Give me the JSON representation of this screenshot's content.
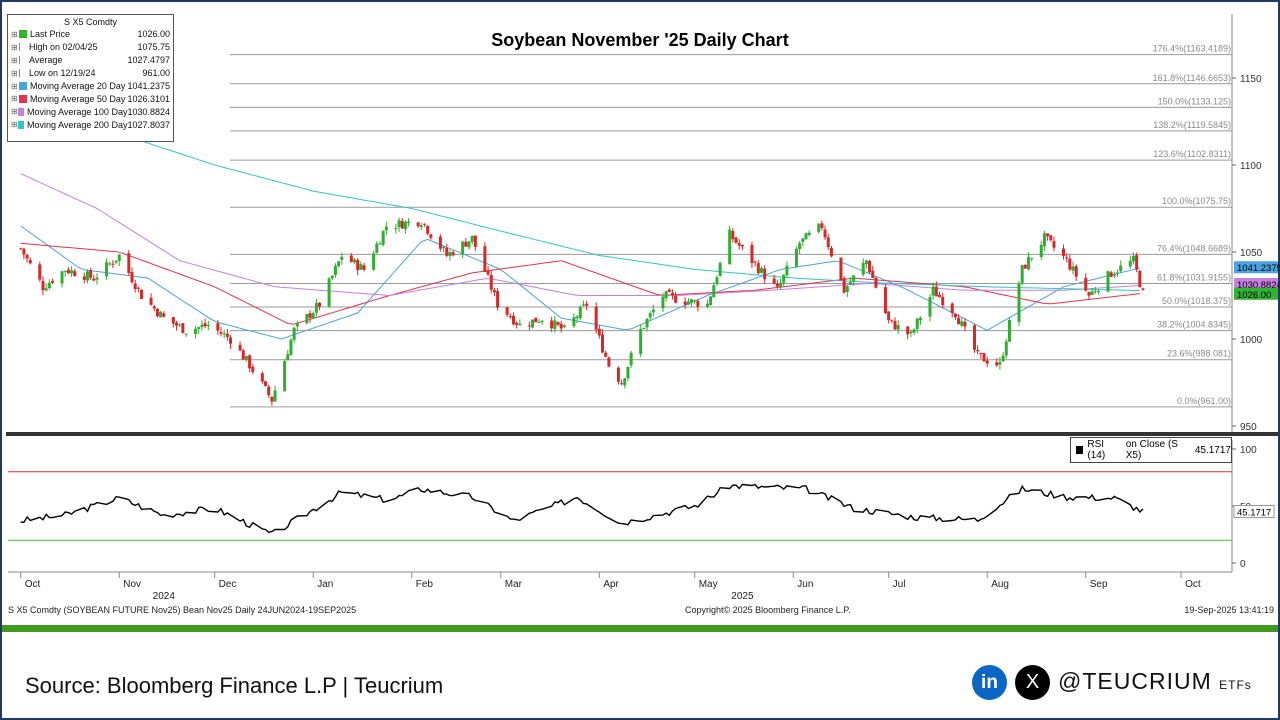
{
  "title": "Soybean November '25 Daily Chart",
  "legend": {
    "title": "S X5 Comdty",
    "rows": [
      {
        "label": "Last Price",
        "value": "1026.00",
        "color": "#2fb52f"
      },
      {
        "label": "High on 02/04/25",
        "value": "1075.75",
        "color": ""
      },
      {
        "label": "Average",
        "value": "1027.4797",
        "color": ""
      },
      {
        "label": "Low on 12/19/24",
        "value": "961.00",
        "color": ""
      },
      {
        "label": "Moving Average 20 Day",
        "value": "1041.2375",
        "color": "#4aa3df"
      },
      {
        "label": "Moving Average 50 Day",
        "value": "1026.3101",
        "color": "#e8314c"
      },
      {
        "label": "Moving Average 100 Day",
        "value": "1030.8824",
        "color": "#c77fe0"
      },
      {
        "label": "Moving Average 200 Day",
        "value": "1027.8037",
        "color": "#2ec7c7"
      }
    ]
  },
  "fib_levels": [
    {
      "label": "176.4%(1163.4189)",
      "value": 1163.4189
    },
    {
      "label": "161.8%(1146.6653)",
      "value": 1146.6653
    },
    {
      "label": "150.0%(1133.125)",
      "value": 1133.125
    },
    {
      "label": "138.2%(1119.5845)",
      "value": 1119.5845
    },
    {
      "label": "123.6%(1102.8311)",
      "value": 1102.8311
    },
    {
      "label": "100.0%(1075.75)",
      "value": 1075.75
    },
    {
      "label": "76.4%(1048.6689)",
      "value": 1048.6689
    },
    {
      "label": "61.8%(1031.9155)",
      "value": 1031.9155
    },
    {
      "label": "50.0%(1018.375)",
      "value": 1018.375
    },
    {
      "label": "38.2%(1004.8345)",
      "value": 1004.8345
    },
    {
      "label": "23.6%(988.081)",
      "value": 988.081
    },
    {
      "label": "0.0%(961.00)",
      "value": 961.0
    }
  ],
  "price_axis": {
    "ticks": [
      "1150",
      "1100",
      "1050",
      "1000",
      "950"
    ],
    "range": [
      950,
      1165
    ]
  },
  "rsi_axis": {
    "ticks": [
      "100",
      "50",
      "0"
    ],
    "overbought": 80,
    "oversold": 20
  },
  "price_tags": [
    {
      "text": "1041.2375",
      "value": 1041.2375,
      "bg": "#4aa3df"
    },
    {
      "text": "1030.8824",
      "value": 1031.6,
      "bg": "#c77fe0"
    },
    {
      "text": "1026.00",
      "value": 1026.0,
      "bg": "#2fb52f"
    }
  ],
  "rsi_box": {
    "label": "RSI (14)",
    "text": "on Close (S X5)",
    "value": "45.1717"
  },
  "rsi_tag": "45.1717",
  "months": [
    "Oct",
    "Nov",
    "Dec",
    "Jan",
    "Feb",
    "Mar",
    "Apr",
    "May",
    "Jun",
    "Jul",
    "Aug",
    "Sep",
    "Oct"
  ],
  "years": [
    "2024",
    "2025"
  ],
  "footer": {
    "left": "S X5 Comdty (SOYBEAN FUTURE   Nov25) Bean Nov25  Daily 24JUN2024-19SEP2025",
    "center": "Copyright© 2025 Bloomberg Finance L.P.",
    "right": "19-Sep-2025 13:41:19"
  },
  "source": "Source: Bloomberg Finance L.P | Teucrium",
  "social": {
    "linkedin": "in",
    "x": "X",
    "handle": "@TEUCRIUM",
    "handle_suffix": "ETFs"
  },
  "chart_data": {
    "type": "line",
    "title": "Soybean November '25 Daily Chart",
    "x_range": [
      "2024-10-01",
      "2025-09-19"
    ],
    "ylim": [
      950,
      1165
    ],
    "close_keypoints": [
      {
        "date": "2024-10-01",
        "value": 1052
      },
      {
        "date": "2024-10-08",
        "value": 1030
      },
      {
        "date": "2024-10-15",
        "value": 1040
      },
      {
        "date": "2024-10-24",
        "value": 1035
      },
      {
        "date": "2024-11-01",
        "value": 1048
      },
      {
        "date": "2024-11-08",
        "value": 1025
      },
      {
        "date": "2024-11-15",
        "value": 1012
      },
      {
        "date": "2024-11-22",
        "value": 1005
      },
      {
        "date": "2024-11-29",
        "value": 1008
      },
      {
        "date": "2024-12-06",
        "value": 1000
      },
      {
        "date": "2024-12-12",
        "value": 985
      },
      {
        "date": "2024-12-19",
        "value": 965
      },
      {
        "date": "2024-12-26",
        "value": 1005
      },
      {
        "date": "2025-01-03",
        "value": 1020
      },
      {
        "date": "2025-01-10",
        "value": 1048
      },
      {
        "date": "2025-01-17",
        "value": 1040
      },
      {
        "date": "2025-01-24",
        "value": 1065
      },
      {
        "date": "2025-02-04",
        "value": 1068
      },
      {
        "date": "2025-02-12",
        "value": 1048
      },
      {
        "date": "2025-02-20",
        "value": 1058
      },
      {
        "date": "2025-02-28",
        "value": 1020
      },
      {
        "date": "2025-03-07",
        "value": 1008
      },
      {
        "date": "2025-03-14",
        "value": 1012
      },
      {
        "date": "2025-03-21",
        "value": 1005
      },
      {
        "date": "2025-03-28",
        "value": 1020
      },
      {
        "date": "2025-04-04",
        "value": 985
      },
      {
        "date": "2025-04-08",
        "value": 975
      },
      {
        "date": "2025-04-14",
        "value": 1005
      },
      {
        "date": "2025-04-21",
        "value": 1025
      },
      {
        "date": "2025-04-28",
        "value": 1022
      },
      {
        "date": "2025-05-05",
        "value": 1020
      },
      {
        "date": "2025-05-12",
        "value": 1060
      },
      {
        "date": "2025-05-19",
        "value": 1045
      },
      {
        "date": "2025-05-27",
        "value": 1028
      },
      {
        "date": "2025-06-03",
        "value": 1055
      },
      {
        "date": "2025-06-10",
        "value": 1065
      },
      {
        "date": "2025-06-17",
        "value": 1028
      },
      {
        "date": "2025-06-24",
        "value": 1045
      },
      {
        "date": "2025-07-01",
        "value": 1010
      },
      {
        "date": "2025-07-08",
        "value": 1002
      },
      {
        "date": "2025-07-15",
        "value": 1028
      },
      {
        "date": "2025-07-22",
        "value": 1015
      },
      {
        "date": "2025-07-29",
        "value": 990
      },
      {
        "date": "2025-08-05",
        "value": 985
      },
      {
        "date": "2025-08-12",
        "value": 1040
      },
      {
        "date": "2025-08-19",
        "value": 1058
      },
      {
        "date": "2025-08-26",
        "value": 1045
      },
      {
        "date": "2025-09-02",
        "value": 1025
      },
      {
        "date": "2025-09-09",
        "value": 1038
      },
      {
        "date": "2025-09-16",
        "value": 1045
      },
      {
        "date": "2025-09-19",
        "value": 1026
      }
    ],
    "series": [
      {
        "name": "Moving Average 20 Day",
        "keypoints": [
          {
            "date": "2024-10-01",
            "value": 1065
          },
          {
            "date": "2024-10-20",
            "value": 1040
          },
          {
            "date": "2024-11-10",
            "value": 1035
          },
          {
            "date": "2024-12-01",
            "value": 1010
          },
          {
            "date": "2024-12-22",
            "value": 1000
          },
          {
            "date": "2025-01-15",
            "value": 1015
          },
          {
            "date": "2025-02-05",
            "value": 1058
          },
          {
            "date": "2025-03-01",
            "value": 1040
          },
          {
            "date": "2025-03-20",
            "value": 1012
          },
          {
            "date": "2025-04-10",
            "value": 1005
          },
          {
            "date": "2025-05-05",
            "value": 1025
          },
          {
            "date": "2025-05-28",
            "value": 1040
          },
          {
            "date": "2025-06-15",
            "value": 1045
          },
          {
            "date": "2025-07-05",
            "value": 1030
          },
          {
            "date": "2025-08-01",
            "value": 1005
          },
          {
            "date": "2025-08-25",
            "value": 1030
          },
          {
            "date": "2025-09-19",
            "value": 1041.24
          }
        ]
      },
      {
        "name": "Moving Average 50 Day",
        "keypoints": [
          {
            "date": "2024-10-01",
            "value": 1055
          },
          {
            "date": "2024-11-01",
            "value": 1050
          },
          {
            "date": "2024-12-01",
            "value": 1030
          },
          {
            "date": "2024-12-25",
            "value": 1008
          },
          {
            "date": "2025-01-25",
            "value": 1025
          },
          {
            "date": "2025-02-20",
            "value": 1038
          },
          {
            "date": "2025-03-20",
            "value": 1045
          },
          {
            "date": "2025-04-20",
            "value": 1025
          },
          {
            "date": "2025-05-20",
            "value": 1028
          },
          {
            "date": "2025-06-20",
            "value": 1035
          },
          {
            "date": "2025-07-25",
            "value": 1030
          },
          {
            "date": "2025-08-20",
            "value": 1020
          },
          {
            "date": "2025-09-19",
            "value": 1026.31
          }
        ]
      },
      {
        "name": "Moving Average 100 Day",
        "keypoints": [
          {
            "date": "2024-10-01",
            "value": 1095
          },
          {
            "date": "2024-10-25",
            "value": 1075
          },
          {
            "date": "2024-11-20",
            "value": 1045
          },
          {
            "date": "2024-12-20",
            "value": 1030
          },
          {
            "date": "2025-01-25",
            "value": 1025
          },
          {
            "date": "2025-02-25",
            "value": 1035
          },
          {
            "date": "2025-03-25",
            "value": 1025
          },
          {
            "date": "2025-04-25",
            "value": 1025
          },
          {
            "date": "2025-05-25",
            "value": 1028
          },
          {
            "date": "2025-06-25",
            "value": 1032
          },
          {
            "date": "2025-07-25",
            "value": 1028
          },
          {
            "date": "2025-08-25",
            "value": 1028
          },
          {
            "date": "2025-09-19",
            "value": 1030.88
          }
        ]
      },
      {
        "name": "Moving Average 200 Day",
        "keypoints": [
          {
            "date": "2024-10-01",
            "value": 1128
          },
          {
            "date": "2024-11-01",
            "value": 1118
          },
          {
            "date": "2024-12-01",
            "value": 1100
          },
          {
            "date": "2025-01-01",
            "value": 1085
          },
          {
            "date": "2025-02-01",
            "value": 1075
          },
          {
            "date": "2025-03-01",
            "value": 1062
          },
          {
            "date": "2025-04-01",
            "value": 1048
          },
          {
            "date": "2025-05-01",
            "value": 1040
          },
          {
            "date": "2025-06-01",
            "value": 1035
          },
          {
            "date": "2025-07-01",
            "value": 1032
          },
          {
            "date": "2025-08-01",
            "value": 1030
          },
          {
            "date": "2025-09-19",
            "value": 1027.8
          }
        ]
      },
      {
        "name": "RSI (14) on Close (S X5)",
        "keypoints": [
          {
            "date": "2024-10-01",
            "value": 37
          },
          {
            "date": "2024-10-15",
            "value": 42
          },
          {
            "date": "2024-11-01",
            "value": 57
          },
          {
            "date": "2024-11-15",
            "value": 42
          },
          {
            "date": "2024-12-01",
            "value": 48
          },
          {
            "date": "2024-12-19",
            "value": 25
          },
          {
            "date": "2025-01-10",
            "value": 62
          },
          {
            "date": "2025-01-25",
            "value": 55
          },
          {
            "date": "2025-02-04",
            "value": 65
          },
          {
            "date": "2025-02-20",
            "value": 58
          },
          {
            "date": "2025-03-05",
            "value": 37
          },
          {
            "date": "2025-03-25",
            "value": 58
          },
          {
            "date": "2025-04-08",
            "value": 35
          },
          {
            "date": "2025-05-01",
            "value": 50
          },
          {
            "date": "2025-05-12",
            "value": 68
          },
          {
            "date": "2025-06-05",
            "value": 65
          },
          {
            "date": "2025-06-20",
            "value": 48
          },
          {
            "date": "2025-07-10",
            "value": 40
          },
          {
            "date": "2025-07-29",
            "value": 38
          },
          {
            "date": "2025-08-12",
            "value": 65
          },
          {
            "date": "2025-08-26",
            "value": 58
          },
          {
            "date": "2025-09-10",
            "value": 57
          },
          {
            "date": "2025-09-19",
            "value": 45.17
          }
        ]
      }
    ]
  }
}
